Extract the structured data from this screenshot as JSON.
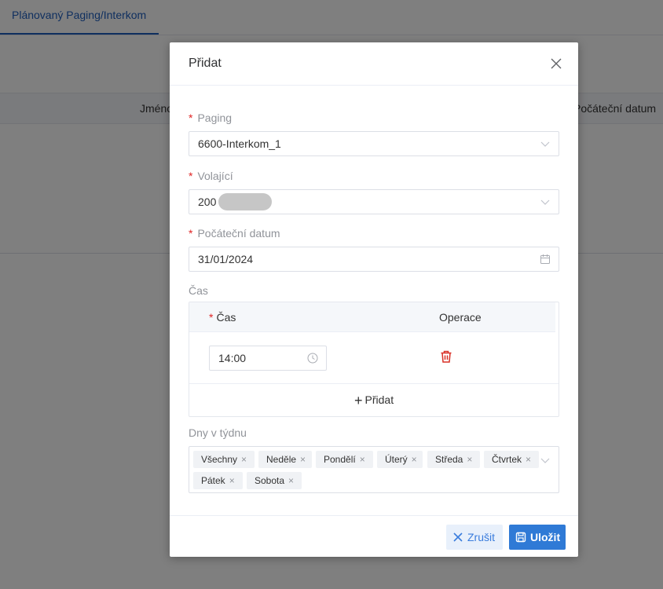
{
  "background": {
    "tab_label": "Plánovaný Paging/Interkom",
    "col_name": "Jméno",
    "col_date": "Počáteční datum"
  },
  "dialog": {
    "title": "Přidat",
    "paging": {
      "label": "Paging",
      "value": "6600-Interkom_1"
    },
    "caller": {
      "label": "Volající",
      "value": "200"
    },
    "start_date": {
      "label": "Počáteční datum",
      "value": "31/01/2024"
    },
    "time_section": {
      "label": "Čas",
      "col_time": "Čas",
      "col_operation": "Operace",
      "rows": [
        {
          "time": "14:00"
        }
      ],
      "add_label": "Přidat"
    },
    "days": {
      "label": "Dny v týdnu",
      "tags": [
        "Všechny",
        "Neděle",
        "Pondělí",
        "Úterý",
        "Středa",
        "Čtvrtek",
        "Pátek",
        "Sobota"
      ]
    },
    "cancel_label": "Zrušit",
    "save_label": "Uložit"
  },
  "colors": {
    "accent": "#2f7ad6",
    "required": "#e02424",
    "delete": "#d93026"
  }
}
